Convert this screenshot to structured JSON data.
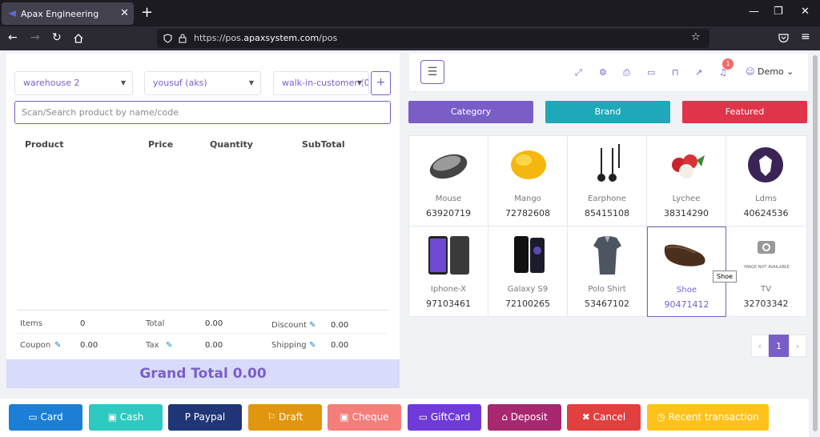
{
  "browser": {
    "tab_title": "Apax Engineering",
    "tab_close": "✕",
    "new_tab": "+",
    "url_prefix": "https://pos.",
    "url_domain": "apaxsystem.com",
    "url_path": "/pos"
  },
  "filters": {
    "warehouse": "warehouse 2",
    "user": "yousuf (aks)",
    "customer": "walk-in-customer (0",
    "add_label": "+"
  },
  "search": {
    "placeholder": "Scan/Search product by name/code"
  },
  "cart_headers": [
    "Product",
    "Price",
    "Quantity",
    "SubTotal"
  ],
  "summary": {
    "items_label": "Items",
    "items_value": "0",
    "total_label": "Total",
    "total_value": "0.00",
    "discount_label": "Discount",
    "discount_value": "0.00",
    "coupon_label": "Coupon",
    "coupon_value": "0.00",
    "tax_label": "Tax",
    "tax_value": "0.00",
    "shipping_label": "Shipping",
    "shipping_value": "0.00"
  },
  "grand_total": "Grand Total 0.00",
  "topbar": {
    "notification_count": "1",
    "user_name": "Demo ⌄"
  },
  "category_buttons": [
    "Category",
    "Brand",
    "Featured"
  ],
  "products": [
    {
      "name": "Mouse",
      "code": "63920719"
    },
    {
      "name": "Mango",
      "code": "72782608"
    },
    {
      "name": "Earphone",
      "code": "85415108"
    },
    {
      "name": "Lychee",
      "code": "38314290"
    },
    {
      "name": "Ldms",
      "code": "40624536"
    },
    {
      "name": "Iphone-X",
      "code": "97103461"
    },
    {
      "name": "Galaxy S9",
      "code": "72100265"
    },
    {
      "name": "Polo Shirt",
      "code": "53467102"
    },
    {
      "name": "Shoe",
      "code": "90471412"
    },
    {
      "name": "TV",
      "code": "32703342"
    }
  ],
  "tv_image_text": "IMAGE NOT AVAILABLE",
  "tooltip": "Shoe",
  "pagination": {
    "prev": "‹",
    "current": "1",
    "next": "›"
  },
  "payment_buttons": [
    {
      "label": "Card",
      "icon": "▭",
      "color": "#1c7fd6"
    },
    {
      "label": "Cash",
      "icon": "▣",
      "color": "#2ec9c0"
    },
    {
      "label": "Paypal",
      "icon": "P",
      "color": "#203575"
    },
    {
      "label": "Draft",
      "icon": "⚐",
      "color": "#e0960f"
    },
    {
      "label": "Cheque",
      "icon": "▣",
      "color": "#f47e7a"
    },
    {
      "label": "GiftCard",
      "icon": "▭",
      "color": "#6f3ad8"
    },
    {
      "label": "Deposit",
      "icon": "⌂",
      "color": "#a8286f"
    },
    {
      "label": "Cancel",
      "icon": "✖",
      "color": "#e23f3f"
    },
    {
      "label": "Recent transaction",
      "icon": "◷",
      "color": "#ffc21a"
    }
  ],
  "colors": {
    "accent": "#7a5ec8",
    "category": "#7a5ec8",
    "brand": "#1fa8b8",
    "featured": "#e0344a"
  }
}
